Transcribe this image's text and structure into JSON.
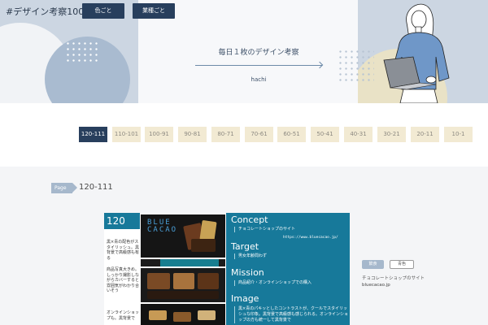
{
  "header": {
    "site_title": "#デザイン考察100",
    "buttons": [
      "色ごと",
      "業種ごと"
    ],
    "tagline": "毎日１枚のデザイン考察",
    "author": "hachi"
  },
  "pagination": {
    "pages": [
      "120-111",
      "110-101",
      "100-91",
      "90-81",
      "80-71",
      "70-61",
      "60-51",
      "50-41",
      "40-31",
      "30-21",
      "20-11",
      "10-1"
    ],
    "active": "120-111"
  },
  "section": {
    "tag": "Page",
    "title": "120-111"
  },
  "card": {
    "number": "120",
    "notes": [
      "黒×青の配色がスタイリッシュ。黒背景で高級感も有る",
      "商品写真大きめ。しっかり撮影しながらカバーすると雰囲気がわかり合いそう",
      "オンラインショップも。黒背景で"
    ],
    "logo_line1": "BLUE",
    "logo_line2": "CACAO",
    "concept_title": "Concept",
    "concept_text": "チョコレートショップのサイト",
    "url": "https://www.bluecacao.jp/",
    "target_title": "Target",
    "target_text": "男女年齢問わず",
    "mission_title": "Mission",
    "mission_text": "商品紹介・オンラインショップでの購入",
    "image_title": "Image",
    "image_text": "黒×青のパキッとしたコントラストが、クールでスタイリッシュな印象。黒背景で高級感も感じられる。オンラインショップの方も統一して黒背景で"
  },
  "side": {
    "tags": [
      "飲食",
      "青色"
    ],
    "description": "チョコレートショップのサイト",
    "url": "bluecacao.jp"
  },
  "colors": {
    "navy": "#283f5d",
    "teal": "#17799a",
    "hero_bg": "#ccd6e2",
    "page_btn": "#f2ead3"
  }
}
